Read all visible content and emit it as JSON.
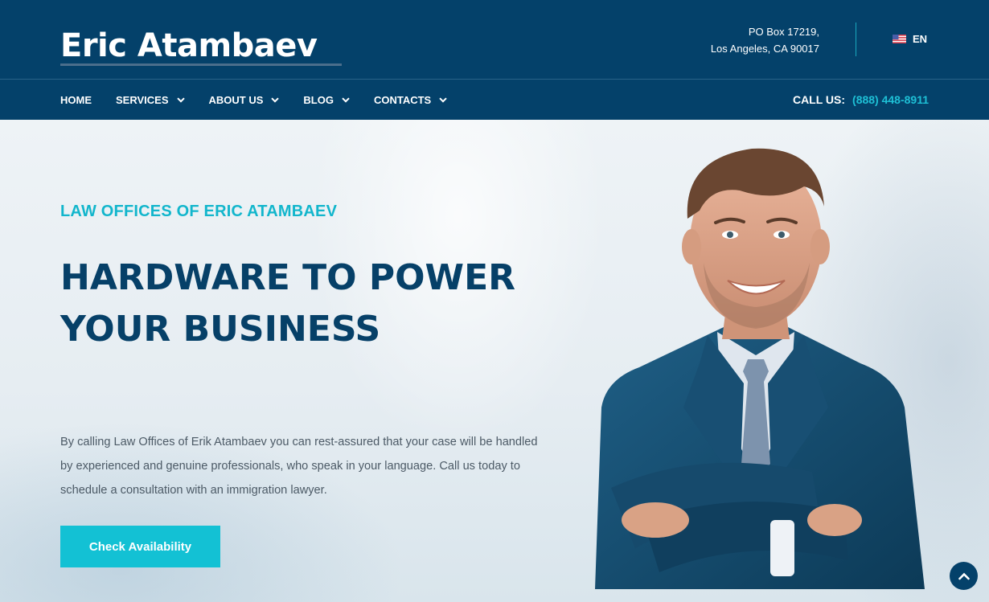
{
  "header": {
    "logo": "Eric Atambaev",
    "address_line1": "PO Box 17219,",
    "address_line2": "Los Angeles, CA 90017",
    "language": "EN"
  },
  "nav": {
    "items": [
      {
        "label": "HOME",
        "has_dropdown": false
      },
      {
        "label": "SERVICES",
        "has_dropdown": true
      },
      {
        "label": "ABOUT US",
        "has_dropdown": true
      },
      {
        "label": "BLOG",
        "has_dropdown": true
      },
      {
        "label": "CONTACTS",
        "has_dropdown": true
      }
    ],
    "call_label": "CALL US:",
    "call_phone": "(888) 448-8911"
  },
  "hero": {
    "pre_title": "LAW OFFICES OF ERIC ATAMBAEV",
    "title_line1": "HARDWARE TO POWER",
    "title_line2": "YOUR BUSINESS",
    "description": "By calling Law Offices of Erik Atambaev you can rest-assured that your case will be handled by experienced and genuine professionals, who speak in your language. Call us today to schedule a consultation with an immigration lawyer.",
    "cta_label": "Check Availability"
  },
  "icons": {
    "flag": "us-flag-icon",
    "dropdown": "chevron-down-icon",
    "scroll_top": "chevron-up-icon"
  },
  "colors": {
    "header_bg": "#04416a",
    "accent": "#13c1d4",
    "title": "#064068"
  }
}
